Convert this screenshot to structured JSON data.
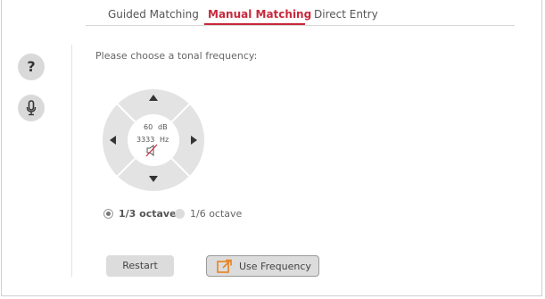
{
  "tabs": [
    {
      "label": "Guided Matching",
      "active": false
    },
    {
      "label": "Manual Matching",
      "active": true
    },
    {
      "label": "Direct Entry",
      "active": false
    }
  ],
  "side_buttons": {
    "help_label": "?",
    "mic_icon": "microphone-icon"
  },
  "prompt": "Please choose a tonal frequency:",
  "dial": {
    "level_value": "60",
    "level_unit": "dB",
    "freq_value": "3333",
    "freq_unit": "Hz",
    "mute_icon": "speaker-muted-icon",
    "arrows": [
      "up",
      "down",
      "left",
      "right"
    ]
  },
  "octave_options": [
    {
      "label": "1/3 octave",
      "selected": true
    },
    {
      "label": "1/6 octave",
      "selected": false
    }
  ],
  "buttons": {
    "restart": "Restart",
    "use_frequency": "Use Frequency"
  },
  "colors": {
    "accent": "#c8283c",
    "icon_orange": "#e8821e",
    "dial_ring": "#e3e3e3",
    "button_bg": "#dcdcdc"
  }
}
